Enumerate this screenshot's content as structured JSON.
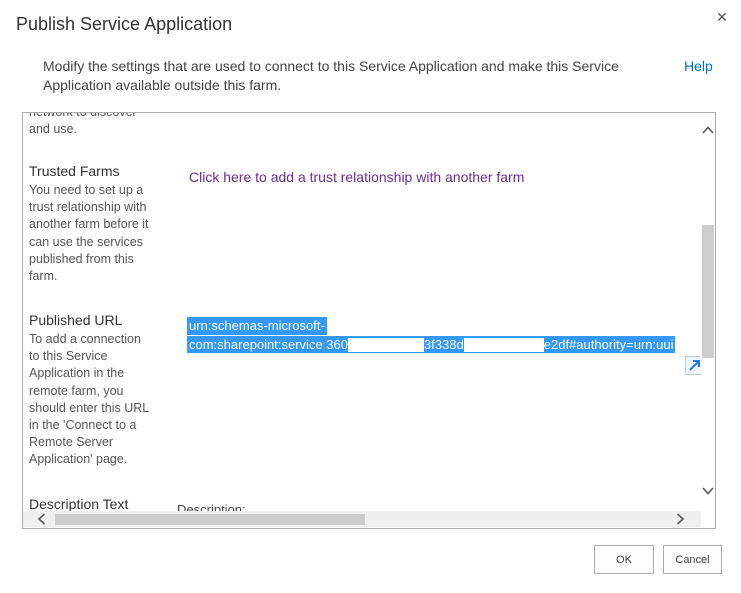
{
  "dialog": {
    "title": "Publish Service Application",
    "intro": "Modify the settings that are used to connect to this Service Application and make this Service Application available outside this farm.",
    "help_label": "Help"
  },
  "sections": {
    "cut_text": "network to discover and use.",
    "trusted_farms": {
      "title": "Trusted Farms",
      "description": "You need to set up a trust relationship with another farm before it can use the services published from this farm.",
      "link": "Click here to add a trust relationship with another farm"
    },
    "published_url": {
      "title": "Published URL",
      "description": "To add a connection to this Service Application in the remote farm, you should enter this URL in the 'Connect to a Remote Server Application' page.",
      "line1": "urn:schemas-microsoft-",
      "line2_a": "com:sharepoint:service:360",
      "line2_b": "3f338d",
      "line2_c": "e2df#authority=urn:uui"
    },
    "description_text": {
      "title": "Description Text",
      "field_label": "Description:"
    }
  },
  "buttons": {
    "ok": "OK",
    "cancel": "Cancel"
  },
  "icons": {
    "close": "close-icon",
    "resize": "resize-icon",
    "scroll_up": "chevron-up-icon",
    "scroll_down": "chevron-down-icon",
    "scroll_left": "chevron-left-icon",
    "scroll_right": "chevron-right-icon"
  },
  "colors": {
    "link": "#0072c6",
    "visited_link": "#6a2d91",
    "selection": "#3399ff"
  }
}
